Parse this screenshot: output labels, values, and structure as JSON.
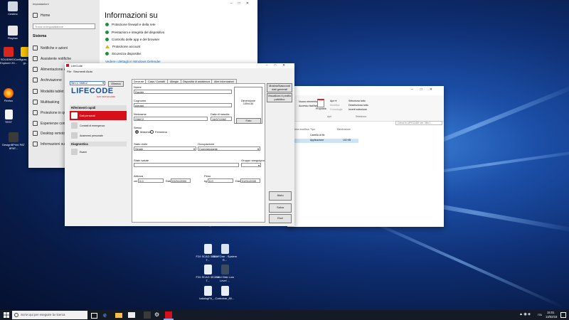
{
  "colors": {
    "accent": "#0078d7",
    "lifecode_blue": "#1a4ea0",
    "lifecode_red": "#d6101a",
    "ok_green": "#1e8f3a",
    "warn_yellow": "#e8b800"
  },
  "desktop": {
    "icons": [
      {
        "label": "Cestino",
        "icon": "recycle-bin-icon"
      },
      {
        "label": "Playbac",
        "icon": "app-icon"
      },
      {
        "label": "SOLIDWO... Explorer 20...",
        "icon": "solidworks-icon"
      },
      {
        "label": "Configura... vision gr...",
        "icon": "app-icon"
      },
      {
        "label": "Firefox",
        "icon": "firefox-icon"
      },
      {
        "label": "TEST",
        "icon": "document-icon"
      },
      {
        "label": "DesignBPrint PAT 8PAT...",
        "icon": "app-icon"
      },
      {
        "label": "Lomat_80...",
        "icon": "document-icon"
      },
      {
        "label": "TOS-WPC 30...",
        "icon": "document-icon"
      },
      {
        "label": "F24 SCAD 301117 T...",
        "icon": "pdf-icon"
      },
      {
        "label": "All in One - System R...",
        "icon": "app-icon"
      },
      {
        "label": "F24 SCAD 301117 T...",
        "icon": "pdf-icon"
      },
      {
        "label": "Hard Disk Low Level ...",
        "icon": "hdd-icon"
      },
      {
        "label": "katalogFA_...",
        "icon": "pdf-icon"
      },
      {
        "label": "Carbobar_80...",
        "icon": "pdf-icon"
      }
    ]
  },
  "settings": {
    "window_title": "Impostazioni",
    "nav": {
      "home": "Home",
      "search_placeholder": "Trova un'impostazione",
      "section": "Sistema",
      "items": [
        "Notifiche e azioni",
        "Assistente notifiche",
        "Alimentazione e sospensione",
        "Archiviazione",
        "Modalità tablet",
        "Multitasking",
        "Proiezione in questo PC",
        "Esperienze condivise",
        "Desktop remoto",
        "Informazioni su"
      ]
    },
    "heading": "Informazioni su",
    "status": [
      {
        "text": "Protezione firewall e della rete",
        "state": "ok"
      },
      {
        "text": "Prestazioni e integrità del dispositivo",
        "state": "ok"
      },
      {
        "text": "Controllo delle app e del browser",
        "state": "ok"
      },
      {
        "text": "Protezione account",
        "state": "warn"
      },
      {
        "text": "Sicurezza dispositivi",
        "state": "ok"
      }
    ],
    "link": "Vedere i dettagli in Windows Defender"
  },
  "explorer": {
    "ribbon": {
      "apri": "Apri ▾",
      "modifica": "Modifica",
      "cronologia": "Cronologia",
      "proprieta": "Proprietà",
      "seleziona_tutto": "Seleziona tutto",
      "deseleziona_tutto": "Deseleziona tutto",
      "inverti_selezione": "Inverti selezione",
      "group_apri": "Apri",
      "group_seleziona": "Seleziona",
      "nuovo_elemento": "Nuovo elemento ▾",
      "accesso_facilitato": "Accesso facilitato ▾"
    },
    "search_placeholder": "Cerca in LIFECODE ver. 'Mis' I...",
    "columns": [
      "Ultima modifica",
      "Tipo",
      "Dimensione"
    ],
    "rows": [
      {
        "date": "...",
        "type": "Cartella di file",
        "size": ""
      },
      {
        "date": "...",
        "type": "Applicazione",
        "size": "102 KB"
      }
    ]
  },
  "lifecode": {
    "title": "LifeCode",
    "menu": [
      "File",
      "Strumenti",
      "Aiuto"
    ],
    "profile_select": "Sim C  SIMC2",
    "search_button": "Elimina",
    "brand": "LIFECODE",
    "brand_tagline": "DATI PER SALVARE",
    "sidebar_header": "Riferimenti rapidi",
    "sidebar_items": [
      "Dati personali",
      "Contatti di emergenza",
      "Anamnesi personale"
    ],
    "section_diagnostica": "Diagnostica",
    "diagnostica_items": [
      "Esami"
    ],
    "tabs": [
      "Generale",
      "Casa / Contatti",
      "Allergie",
      "Dispositivi di assistenza",
      "Altre Informazioni"
    ],
    "form": {
      "nome_label": "Nome",
      "nome_value": "Davide",
      "cognome_label": "Cognome",
      "cognome_value": "pierani",
      "nickname_label": "Nickname",
      "nickname_value": "SIMC2",
      "dob_label": "Data di nascita",
      "dob_value": "14/07/1962",
      "sesso_label": "Sesso",
      "sesso_m": "Maschio",
      "sesso_f": "Femmina",
      "stato_civile_label": "Stato civile",
      "stato_civile_value": "Single",
      "occupazione_label": "Occupazione",
      "occupazione_value": "Commerciante",
      "stato_salute_label": "Stato salute",
      "stato_salute_value": "",
      "gruppo_sanguigno_label": "Gruppo sanguigno",
      "gruppo_sanguigno_value": "",
      "altezza_label": "Altezza",
      "altezza_unit": "cm",
      "altezza_value": "0,0",
      "altezza_date_label": "Data",
      "altezza_date": "01/01/2000",
      "peso_label": "Peso",
      "peso_unit": "kg",
      "peso_value": "0,0",
      "peso_date_label": "Data",
      "peso_date": "01/01/2000"
    },
    "photo_text": "Dimensione 100x130",
    "photo_button": "Foto",
    "right_buttons": [
      "Mostra/Nascondi dati generali",
      "Visualizza il profilo pubblico"
    ],
    "bottom_buttons": [
      "Aiuto",
      "Salva",
      "Esci"
    ]
  },
  "taskbar": {
    "search_placeholder": "Scrivi qui per eseguire la ricerca",
    "time": "15:01",
    "date": "13/02/18",
    "lang": "ITA"
  }
}
